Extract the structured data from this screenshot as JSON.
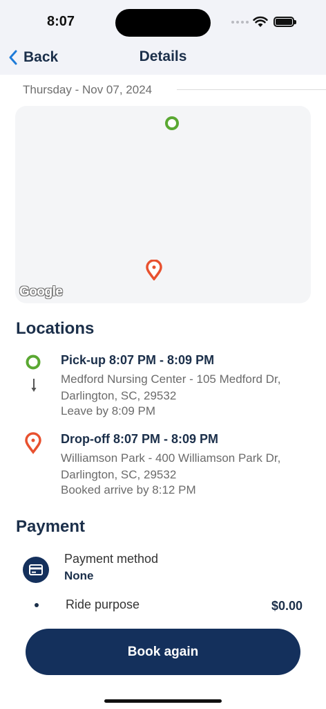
{
  "status_bar": {
    "time": "8:07"
  },
  "nav": {
    "back_label": "Back",
    "title": "Details"
  },
  "trip": {
    "date": "Thursday - Nov 07, 2024"
  },
  "map": {
    "attribution": "Google",
    "origin_icon": "origin-circle-icon",
    "destination_icon": "destination-pin-icon"
  },
  "locations": {
    "title": "Locations",
    "pickup": {
      "title": "Pick-up 8:07 PM - 8:09 PM",
      "address": "Medford Nursing Center - 105 Medford Dr, Darlington, SC, 29532",
      "note": "Leave by 8:09 PM"
    },
    "dropoff": {
      "title": "Drop-off 8:07 PM - 8:09 PM",
      "address": "Williamson Park - 400 Williamson Park Dr, Darlington, SC, 29532",
      "note": "Booked arrive by 8:12 PM"
    }
  },
  "payment": {
    "title": "Payment",
    "method_label": "Payment method",
    "method_value": "None",
    "purpose_label": "Ride purpose",
    "purpose_amount": "$0.00"
  },
  "actions": {
    "book_again_label": "Book again"
  },
  "colors": {
    "primary": "#14305c",
    "pickup": "#5aa832",
    "dropoff": "#e8512f",
    "background_bar": "#f2f3f8"
  }
}
